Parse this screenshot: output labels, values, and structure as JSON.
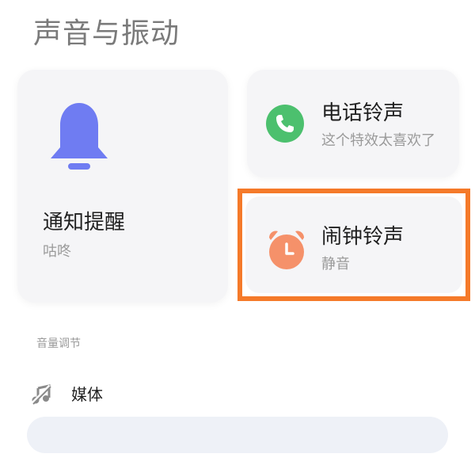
{
  "page": {
    "title": "声音与振动"
  },
  "cards": {
    "notification": {
      "title": "通知提醒",
      "subtitle": "咕咚",
      "icon": "bell-icon",
      "color": "#6f7cf2"
    },
    "phone": {
      "title": "电话铃声",
      "subtitle": "这个特效太喜欢了",
      "icon": "phone-icon",
      "color": "#4cc06e"
    },
    "alarm": {
      "title": "闹钟铃声",
      "subtitle": "静音",
      "icon": "alarm-clock-icon",
      "color": "#f5916a",
      "highlight_color": "#f57a2a"
    }
  },
  "volume": {
    "section_label": "音量调节",
    "media": {
      "label": "媒体",
      "icon": "music-muted-icon",
      "level": 0
    }
  }
}
